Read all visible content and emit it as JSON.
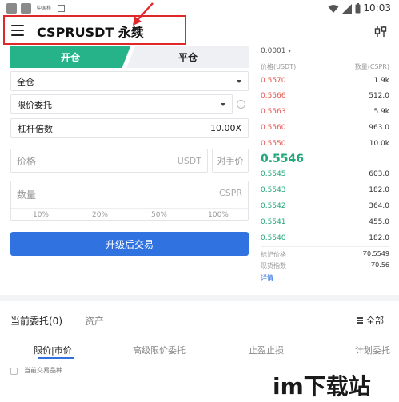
{
  "status_bar": {
    "carrier_small": "中国移",
    "time": "10:03"
  },
  "header": {
    "pair": "CSPRUSDT 永续",
    "annotation_color": "#e0282c"
  },
  "trade_tabs": {
    "open": "开仓",
    "close": "平仓",
    "accent": "#26b38a"
  },
  "form": {
    "margin_mode": "全仓",
    "order_type": "限价委托",
    "leverage_label": "杠杆倍数",
    "leverage_value": "10.00X",
    "price_placeholder": "价格",
    "price_unit": "USDT",
    "counterparty_price": "对手价",
    "qty_placeholder": "数量",
    "qty_unit": "CSPR",
    "percent_options": [
      "10%",
      "20%",
      "50%",
      "100%"
    ],
    "submit": "升级后交易"
  },
  "order_book": {
    "precision": "0.0001",
    "header_price": "价格(USDT)",
    "header_qty": "数量(CSPR)",
    "asks": [
      {
        "price": "0.5570",
        "qty": "1.9k"
      },
      {
        "price": "0.5566",
        "qty": "512.0"
      },
      {
        "price": "0.5563",
        "qty": "5.9k"
      },
      {
        "price": "0.5560",
        "qty": "963.0"
      },
      {
        "price": "0.5550",
        "qty": "10.0k"
      }
    ],
    "last_price": "0.5546",
    "bids": [
      {
        "price": "0.5545",
        "qty": "603.0"
      },
      {
        "price": "0.5543",
        "qty": "182.0"
      },
      {
        "price": "0.5542",
        "qty": "364.0"
      },
      {
        "price": "0.5541",
        "qty": "455.0"
      },
      {
        "price": "0.5540",
        "qty": "182.0"
      }
    ],
    "mark_price_label": "标记价格",
    "mark_price_value": "₮0.5549",
    "index_label": "现货指数",
    "index_value": "₮0.56",
    "details": "详情"
  },
  "orders": {
    "tab_current": "当前委托(0)",
    "tab_assets": "资产",
    "filter": "全部",
    "subtabs": [
      "限价|市价",
      "高级限价委托",
      "止盈止损",
      "计划委托"
    ],
    "checkbox_label": "当前交易品种"
  },
  "watermark": "im下载站"
}
